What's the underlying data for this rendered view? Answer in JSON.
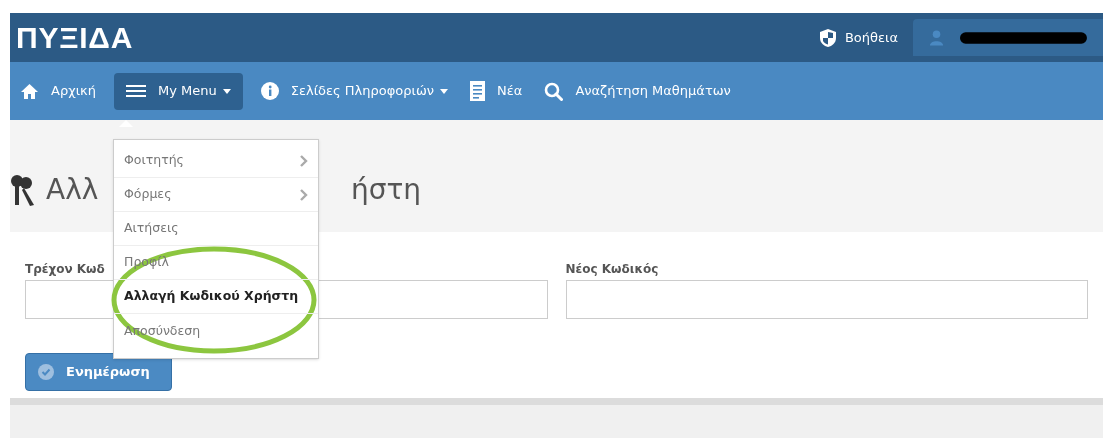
{
  "header": {
    "logo": "ΠΥΞΙΔΑ",
    "help": "Βοήθεια"
  },
  "nav": [
    {
      "label": "Αρχική",
      "selected": false,
      "dropdown": false
    },
    {
      "label": "My Menu",
      "selected": true,
      "dropdown": true
    },
    {
      "label": "Σελίδες Πληροφοριών",
      "selected": false,
      "dropdown": true
    },
    {
      "label": "Νέα",
      "selected": false,
      "dropdown": false
    },
    {
      "label": "Αναζήτηση Μαθημάτων",
      "selected": false,
      "dropdown": false
    }
  ],
  "menu": [
    {
      "label": "Φοιτητής",
      "submenu": true,
      "selected": false
    },
    {
      "label": "Φόρμες",
      "submenu": true,
      "selected": false
    },
    {
      "label": "Αιτήσεις",
      "submenu": false,
      "selected": false
    },
    {
      "label": "Προφίλ",
      "submenu": false,
      "selected": false
    },
    {
      "label": "Αλλαγή Κωδικού Χρήστη",
      "submenu": false,
      "selected": true
    },
    {
      "label": "Αποσύνδεση",
      "submenu": false,
      "selected": false
    }
  ],
  "page_title": {
    "left_part": "Αλλ",
    "right_part": "ήστη"
  },
  "form": {
    "fields": [
      {
        "label": "Τρέχον Κωδ"
      },
      {
        "label": "Νέος Κωδικός"
      }
    ],
    "button": "Ενημέρωση"
  }
}
